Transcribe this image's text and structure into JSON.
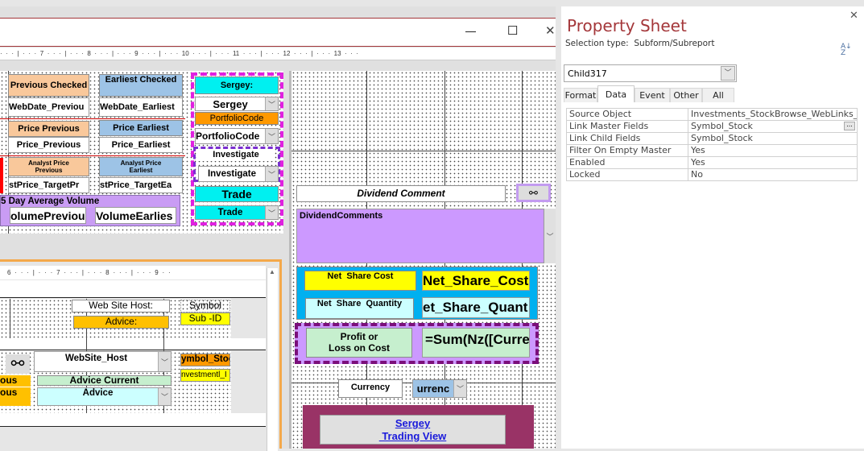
{
  "window": {
    "minimize": "—",
    "maximize": "☐",
    "close": "✕"
  },
  "ruler_top": "· · · | · · · 7 · · · | · · · 8 · · · | · · · 9 · · · | · · · 10 · · · | · · · 11 · · · | · · · 12 · · · | · · · 13 · · ·",
  "ruler_sub": "6 · · · | · · · 7 · · · | · · · 8 · · · | · · · 9 · ·",
  "left": {
    "previous_checked": "Previous Checked",
    "earliest_checked": "Earliest Checked",
    "webdate_previous": "WebDate_Previou",
    "webdate_earliest": "WebDate_Earliest",
    "price_previous_label": "Price Previous",
    "price_earliest_label": "Price Earliest",
    "price_previous": "Price_Previous",
    "price_earliest": "Price_Earliest",
    "analyst_previous": "Analyst Price Previous",
    "analyst_earliest": "Analyst Price Earliest",
    "target_previous": "stPrice_TargetPr",
    "target_earliest": "stPrice_TargetEa",
    "volume_label": "5 Day Average Volume",
    "volume_previous": "olumePreviou",
    "volume_earliest": "VolumeEarlies"
  },
  "group": {
    "sergey_label": "Sergey:",
    "sergey": "Sergey",
    "portfolio_label": "PortfolioCode",
    "portfolio": "PortfolioCode",
    "investigate_label": "Investigate",
    "investigate": "Investigate",
    "trade_label": "Trade",
    "trade": "Trade"
  },
  "subform": {
    "web_site_host_label": "Web Site Host:",
    "advice_label": "Advice:",
    "symbol_label": "Symbol",
    "sub_id_label": "Sub -ID",
    "website_host": "WebSite_Host",
    "advice_current": "Advice Current",
    "advice": "Advice",
    "symbol_stock": "ymbol_Stoc",
    "investment_id": "nvestmentl_I",
    "prev1": "ous",
    "prev2": "ous"
  },
  "right": {
    "dividend_comment": "Dividend Comment",
    "dividend_comments": "DividendComments",
    "net_share_cost_label": "Net  Share Cost",
    "net_share_cost": "Net_Share_Cost",
    "net_share_qty_label": "Net  Share  Quantity",
    "net_share_qty": "et_Share_Quant",
    "profit_label": "Profit or\nLoss on Cost",
    "profit_expr": "=Sum(Nz([Current_Price])",
    "currency_label": "Currency",
    "currency": "urrenc",
    "link_line1": "Sergey",
    "link_line2": " Trading View"
  },
  "property_sheet": {
    "title": "Property Sheet",
    "selection_type": "Selection type:  Subform/Subreport",
    "sort_icon": "A↓Z",
    "close": "✕",
    "object": "Child317",
    "tabs": [
      "Format",
      "Data",
      "Event",
      "Other",
      "All"
    ],
    "active_tab": "Data",
    "rows": [
      {
        "key": "Source Object",
        "value": "Investments_StockBrowse_WebLinks_F_S"
      },
      {
        "key": "Link Master Fields",
        "value": "Symbol_Stock"
      },
      {
        "key": "Link Child Fields",
        "value": "Symbol_Stock"
      },
      {
        "key": "Filter On Empty Master",
        "value": "Yes"
      },
      {
        "key": "Enabled",
        "value": "Yes"
      },
      {
        "key": "Locked",
        "value": "No"
      }
    ],
    "builder": "..."
  }
}
